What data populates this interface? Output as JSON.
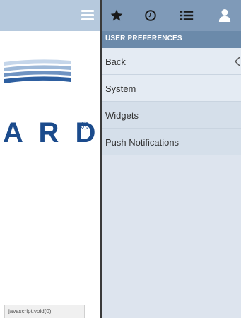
{
  "left_pane": {
    "brand_text": "A R D",
    "brand_mark": "®",
    "status_text": "javascript:void(0)"
  },
  "drawer": {
    "header_icons": [
      "star-icon",
      "clock-icon",
      "list-icon",
      "user-icon"
    ],
    "section_title": "USER PREFERENCES",
    "items": [
      {
        "label": "Back"
      },
      {
        "label": "System"
      },
      {
        "label": "Widgets"
      },
      {
        "label": "Push Notifications"
      }
    ]
  },
  "colors": {
    "header_left": "#b6c9dd",
    "header_right": "#7f9ab8",
    "section_bar": "#6b8aaa",
    "drawer_bg": "#dde4ee",
    "brand": "#1b4b8c"
  }
}
